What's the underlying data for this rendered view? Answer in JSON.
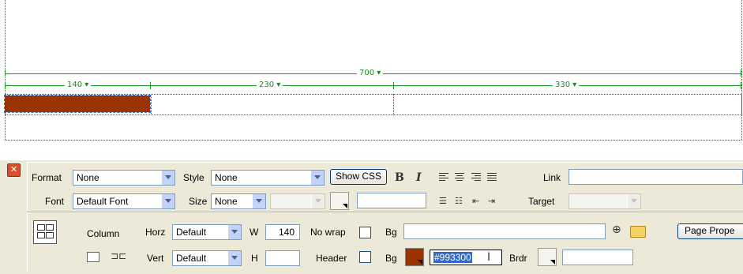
{
  "canvas": {
    "table_width_label": "700 ▾",
    "col_width_labels": [
      "140 ▾",
      "230 ▾",
      "330 ▾"
    ],
    "cell_bg": "#993300",
    "selection_color": "#3a6fd0",
    "ruler_color": "#1a9a1a"
  },
  "inspector": {
    "close_icon": "close-icon",
    "row1": {
      "format_label": "Format",
      "format_value": "None",
      "style_label": "Style",
      "style_value": "None",
      "show_css_label": "Show CSS",
      "bold_label": "B",
      "italic_label": "I",
      "link_label": "Link",
      "link_value": ""
    },
    "row2": {
      "font_label": "Font",
      "font_value": "Default Font",
      "size_label": "Size",
      "size_value": "None",
      "target_label": "Target"
    },
    "row3": {
      "column_label": "Column",
      "horz_label": "Horz",
      "horz_value": "Default",
      "w_label": "W",
      "w_value": "140",
      "nowrap_label": "No wrap",
      "bg_label": "Bg",
      "bg_image_value": "",
      "page_props_label": "Page Prope"
    },
    "row4": {
      "vert_label": "Vert",
      "vert_value": "Default",
      "h_label": "H",
      "h_value": "",
      "header_label": "Header",
      "bg_label": "Bg",
      "bg_color_value": "#993300",
      "bg_color_swatch": "#993300",
      "brdr_label": "Brdr",
      "brdr_value": ""
    }
  }
}
